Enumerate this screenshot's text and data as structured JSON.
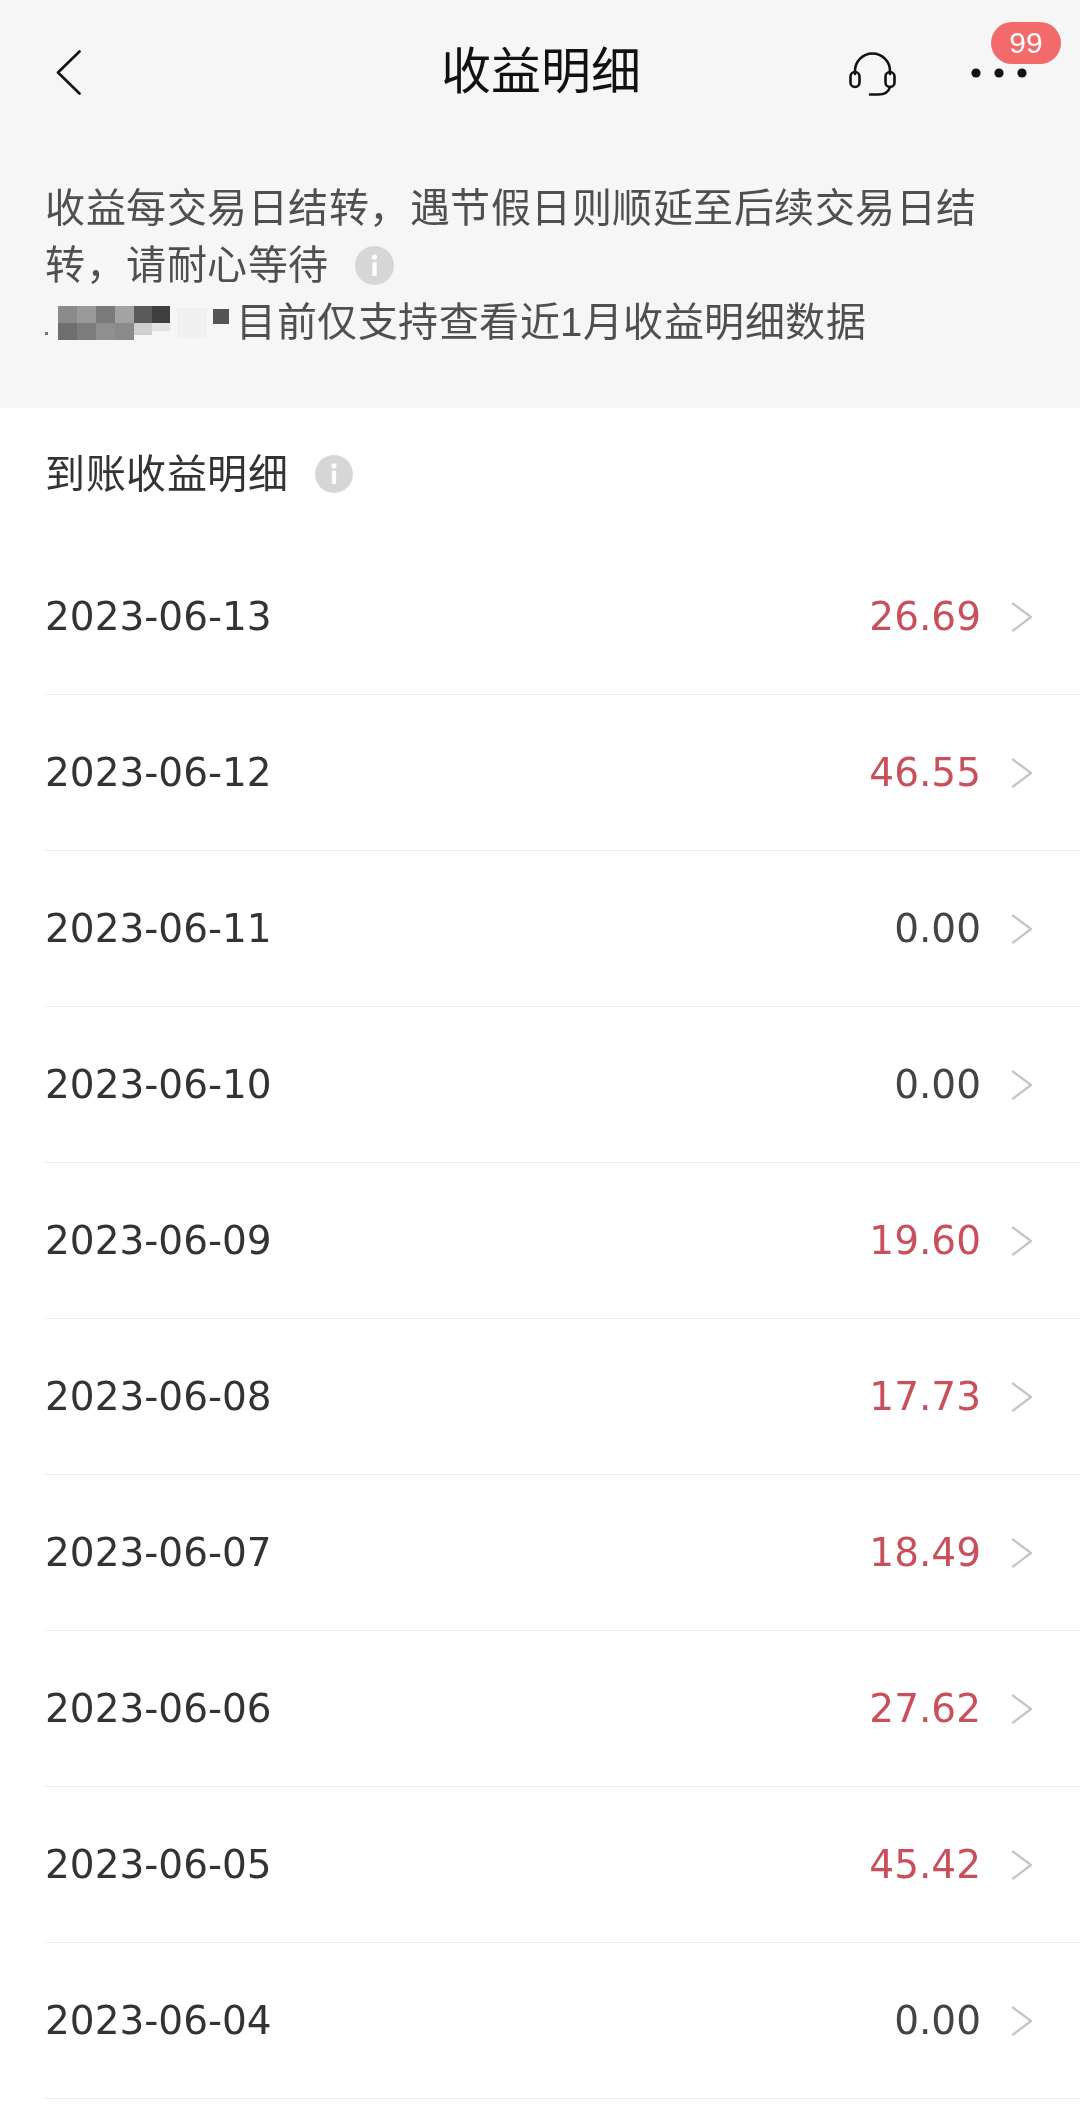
{
  "header": {
    "title": "收益明细",
    "more_badge": "99"
  },
  "notice": {
    "lines": [
      "收益每交易日结转，遇节假日则顺延至后续交易日结",
      "转，请耐心等待"
    ],
    "range_note": "目前仅支持查看近1月收益明细数据"
  },
  "section": {
    "title": "到账收益明细"
  },
  "rows": [
    {
      "date": "2023-06-13",
      "amount": "26.69",
      "color": "#c94f5b"
    },
    {
      "date": "2023-06-12",
      "amount": "46.55",
      "color": "#c94f5b"
    },
    {
      "date": "2023-06-11",
      "amount": "0.00",
      "color": "#444444"
    },
    {
      "date": "2023-06-10",
      "amount": "0.00",
      "color": "#444444"
    },
    {
      "date": "2023-06-09",
      "amount": "19.60",
      "color": "#c94f5b"
    },
    {
      "date": "2023-06-08",
      "amount": "17.73",
      "color": "#c94f5b"
    },
    {
      "date": "2023-06-07",
      "amount": "18.49",
      "color": "#c94f5b"
    },
    {
      "date": "2023-06-06",
      "amount": "27.62",
      "color": "#c94f5b"
    },
    {
      "date": "2023-06-05",
      "amount": "45.42",
      "color": "#c94f5b"
    },
    {
      "date": "2023-06-04",
      "amount": "0.00",
      "color": "#444444"
    }
  ]
}
